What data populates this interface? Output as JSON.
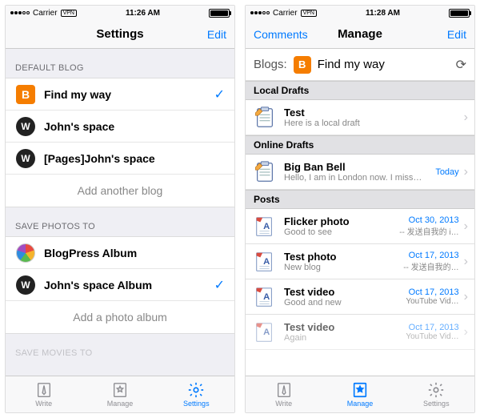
{
  "left": {
    "status": {
      "carrier": "Carrier",
      "vpn": "VPN",
      "time": "11:26 AM"
    },
    "nav": {
      "title": "Settings",
      "edit": "Edit"
    },
    "sections": {
      "defaultBlog": {
        "header": "DEFAULT BLOG",
        "items": [
          {
            "label": "Find my way",
            "checked": true
          },
          {
            "label": "John's space",
            "checked": false
          },
          {
            "label": "[Pages]John's space",
            "checked": false
          }
        ],
        "add": "Add another blog"
      },
      "savePhotos": {
        "header": "SAVE PHOTOS TO",
        "items": [
          {
            "label": "BlogPress Album",
            "checked": false
          },
          {
            "label": "John's space Album",
            "checked": true
          }
        ],
        "add": "Add a photo album"
      },
      "saveMovies": {
        "header": "SAVE MOVIES TO"
      }
    },
    "tabs": {
      "write": "Write",
      "manage": "Manage",
      "settings": "Settings"
    }
  },
  "right": {
    "status": {
      "carrier": "Carrier",
      "vpn": "VPN",
      "time": "11:28 AM"
    },
    "nav": {
      "left": "Comments",
      "title": "Manage",
      "edit": "Edit"
    },
    "blogbar": {
      "label": "Blogs:",
      "name": "Find my way"
    },
    "groups": {
      "localDrafts": {
        "header": "Local Drafts",
        "items": [
          {
            "title": "Test",
            "sub": "Here is a local draft"
          }
        ]
      },
      "onlineDrafts": {
        "header": "Online Drafts",
        "items": [
          {
            "title": "Big Ban Bell",
            "sub": "Hello, I am in London now. I miss…",
            "date": "Today"
          }
        ]
      },
      "posts": {
        "header": "Posts",
        "items": [
          {
            "title": "Flicker photo",
            "sub": "Good to see",
            "date": "Oct 30, 2013",
            "extra": "-- 发送自我的 i…"
          },
          {
            "title": "Test photo",
            "sub": "New blog",
            "date": "Oct 17, 2013",
            "extra": "-- 发送自我的…"
          },
          {
            "title": "Test video",
            "sub": "Good and new",
            "date": "Oct 17, 2013",
            "extra": "YouTube Vid…"
          },
          {
            "title": "Test video",
            "sub": "Again",
            "date": "Oct 17, 2013",
            "extra": "YouTube Vid…"
          }
        ]
      }
    },
    "tabs": {
      "write": "Write",
      "manage": "Manage",
      "settings": "Settings"
    }
  }
}
